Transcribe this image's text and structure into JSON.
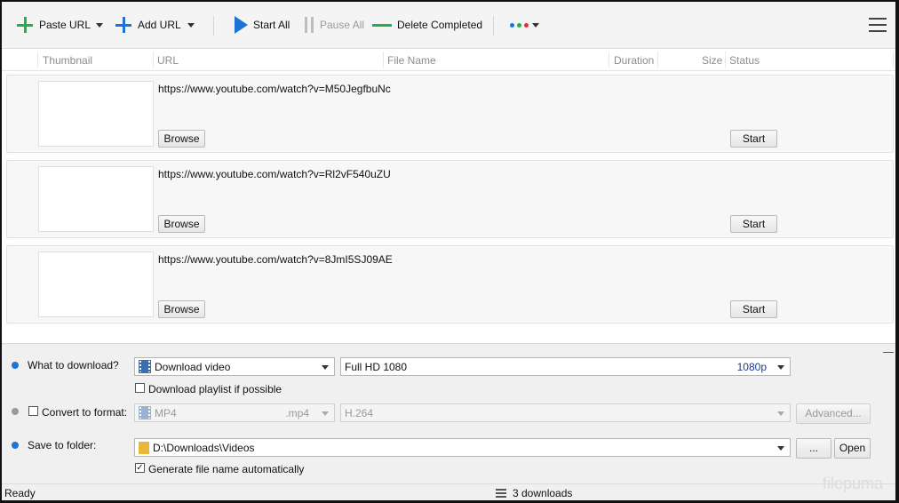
{
  "toolbar": {
    "paste_url": "Paste URL",
    "add_url": "Add URL",
    "start_all": "Start All",
    "pause_all": "Pause All",
    "delete_completed": "Delete Completed",
    "dot_colors": [
      "#1e73d8",
      "#22b14c",
      "#e03030"
    ],
    "icons": {
      "paste": "plus-icon",
      "add": "plus-icon",
      "start": "play-icon",
      "pause": "pause-icon",
      "delete": "minus-line-icon",
      "more": "dots-icon",
      "menu": "hamburger-menu-icon"
    }
  },
  "columns": [
    "Thumbnail",
    "URL",
    "File Name",
    "Duration",
    "Size",
    "Status"
  ],
  "downloads": [
    {
      "url": "https://www.youtube.com/watch?v=M50JegfbuNc",
      "browse": "Browse",
      "start": "Start"
    },
    {
      "url": "https://www.youtube.com/watch?v=Rl2vF540uZU",
      "browse": "Browse",
      "start": "Start"
    },
    {
      "url": "https://www.youtube.com/watch?v=8JmI5SJ09AE",
      "browse": "Browse",
      "start": "Start"
    }
  ],
  "options": {
    "what_label": "What to download?",
    "download_type": "Download video",
    "quality": "Full HD 1080",
    "quality_badge": "1080p",
    "playlist_label": "Download playlist if possible",
    "playlist_checked": false,
    "convert_label": "Convert to format:",
    "convert_checked": false,
    "format": "MP4",
    "format_ext": ".mp4",
    "codec": "H.264",
    "advanced": "Advanced...",
    "save_label": "Save to folder:",
    "folder": "D:\\Downloads\\Videos",
    "browse_dots": "...",
    "open": "Open",
    "autoname_label": "Generate file name automatically",
    "autoname_checked": true,
    "bullet_colors": {
      "what": "#1e73d8",
      "convert": "#9a9a9a",
      "save": "#1e73d8"
    }
  },
  "statusbar": {
    "status": "Ready",
    "count": "3 downloads"
  },
  "watermark": "filepuma"
}
